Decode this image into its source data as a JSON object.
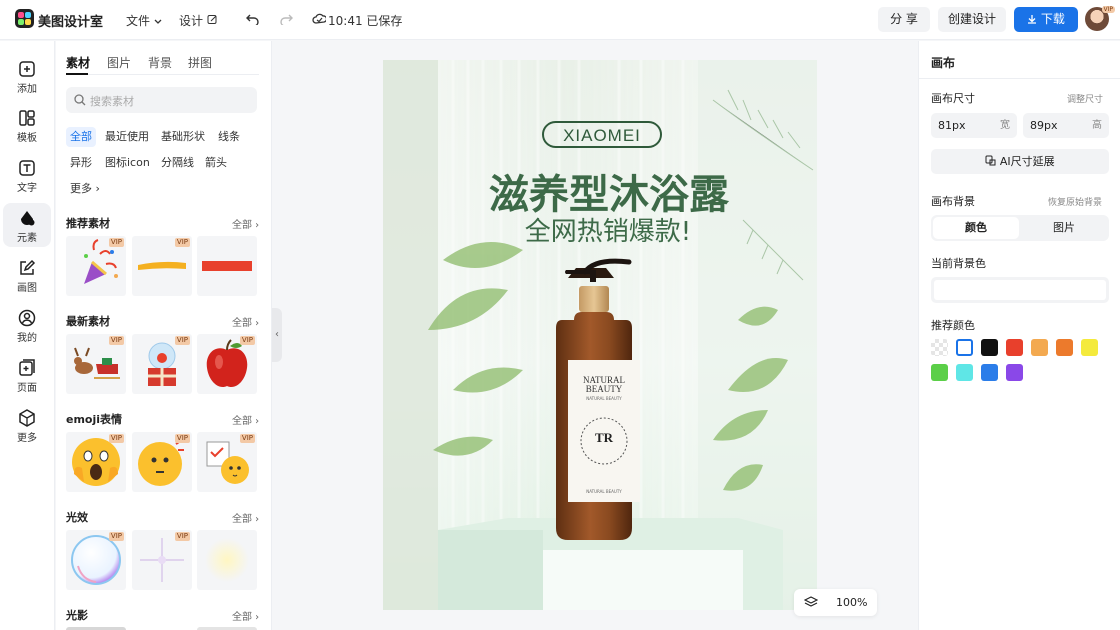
{
  "app": {
    "brand": "美图设计室"
  },
  "topbar": {
    "menu_file": "文件",
    "menu_design": "设计",
    "save_status": "10:41 已保存",
    "share_label": "分 享",
    "create_label": "创建设计",
    "download_label": "下载",
    "avatar_badge": "VIP",
    "colors": {
      "primary": "#1a73e8"
    }
  },
  "rail": {
    "items": [
      {
        "label": "添加",
        "icon": "add-icon"
      },
      {
        "label": "模板",
        "icon": "template-icon"
      },
      {
        "label": "文字",
        "icon": "text-icon"
      },
      {
        "label": "元素",
        "icon": "element-icon"
      },
      {
        "label": "画图",
        "icon": "draw-icon"
      },
      {
        "label": "我的",
        "icon": "user-icon"
      },
      {
        "label": "页面",
        "icon": "page-icon"
      },
      {
        "label": "更多",
        "icon": "cube-icon"
      }
    ],
    "active_index": 3
  },
  "assets": {
    "tabs": [
      "素材",
      "图片",
      "背景",
      "拼图"
    ],
    "active_tab": 0,
    "search_placeholder": "搜索素材",
    "chips": [
      "全部",
      "最近使用",
      "基础形状",
      "线条",
      "异形",
      "图标icon",
      "分隔线",
      "箭头",
      "更多"
    ],
    "active_chip": 0,
    "all_label": "全部",
    "vip_label": "VIP",
    "sections": [
      {
        "title": "推荐素材"
      },
      {
        "title": "最新素材"
      },
      {
        "title": "emoji表情"
      },
      {
        "title": "光效"
      },
      {
        "title": "光影"
      }
    ]
  },
  "poster": {
    "brand": "XIAOMEI",
    "headline": "滋养型沐浴露",
    "subheadline": "全网热销爆款!",
    "label_line1": "NATURAL",
    "label_line2": "BEAUTY",
    "label_small": "NATURAL BEAUTY",
    "label_mark": "TR",
    "label_bottom": "NATURAL BEAUTY"
  },
  "canvas": {
    "zoom": "100%"
  },
  "right_panel": {
    "title": "画布",
    "size_title": "画布尺寸",
    "size_action": "调整尺寸",
    "width_value": "81px",
    "width_label": "宽",
    "height_value": "89px",
    "height_label": "高",
    "ai_button": "AI尺寸延展",
    "bg_title": "画布背景",
    "bg_reset": "恢复原始背景",
    "seg_color": "颜色",
    "seg_image": "图片",
    "current_bg_label": "当前背景色",
    "recommend_label": "推荐颜色",
    "recommended_colors": [
      "transparent",
      "#ffffff",
      "#111111",
      "#e8402c",
      "#f3a950",
      "#ec7a2c",
      "#f4ea3c",
      "#5bcf48",
      "#5fe6e6",
      "#2b7de9",
      "#8a48e8"
    ]
  }
}
